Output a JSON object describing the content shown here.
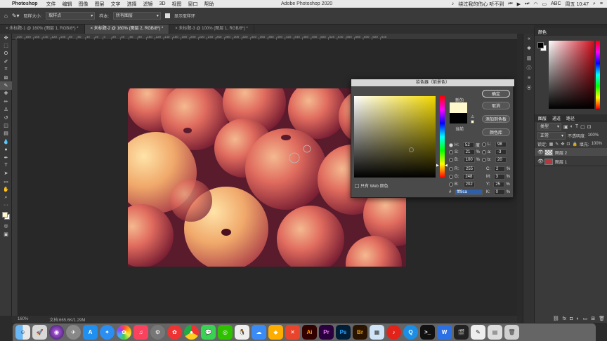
{
  "menubar": {
    "apple": "",
    "app_name": "Photoshop",
    "items": [
      "文件",
      "编辑",
      "图像",
      "图层",
      "文字",
      "选择",
      "滤镜",
      "3D",
      "视图",
      "窗口",
      "帮助"
    ],
    "window_title": "Adobe Photoshop 2020",
    "song": "绕过我的伤心 听不到",
    "input_method": "ABC",
    "clock": "周五 10:47"
  },
  "options_bar": {
    "sample_size_label": "取样大小:",
    "sample_size_value": "取样点",
    "sample_label": "样本:",
    "sample_value": "所有图层",
    "show_ring_label": "显示取样环"
  },
  "tabs": [
    {
      "label": "未标题-1 @ 160% (图层 1, RGB/8*) *",
      "active": false
    },
    {
      "label": "未标题-2 @ 160% (图层 2, RGB/8*) *",
      "active": true
    },
    {
      "label": "未标题-3 @ 100% (图层 1, RGB/8*) *",
      "active": false
    }
  ],
  "ruler_ticks": [
    "200",
    "180",
    "160",
    "140",
    "120",
    "100",
    "80",
    "60",
    "40",
    "20",
    "0",
    "20",
    "40",
    "60",
    "80",
    "100",
    "120",
    "140",
    "160",
    "180",
    "200",
    "220",
    "240",
    "260",
    "280",
    "300",
    "320",
    "340",
    "360",
    "380",
    "400",
    "420",
    "440",
    "460",
    "480",
    "500",
    "520",
    "540",
    "560",
    "580",
    "600",
    "620",
    "640"
  ],
  "status": {
    "zoom": "160%",
    "doc": "文档:665.6K/1.29M"
  },
  "color_picker": {
    "title": "拾色器（前景色）",
    "ok": "确定",
    "cancel": "取消",
    "add_swatch": "添加到色板",
    "libraries": "颜色库",
    "new_label": "新的",
    "current_label": "当前",
    "web_only_label": "只有 Web 颜色",
    "new_color": "#fff8ca",
    "current_color": "#000000",
    "fields": {
      "H": {
        "value": "52",
        "unit": "度"
      },
      "S": {
        "value": "21",
        "unit": "%"
      },
      "B": {
        "value": "100",
        "unit": "%"
      },
      "R": {
        "value": "255",
        "unit": ""
      },
      "G": {
        "value": "248",
        "unit": ""
      },
      "Bv": {
        "value": "202",
        "unit": ""
      },
      "L": {
        "value": "98",
        "unit": ""
      },
      "a": {
        "value": "-3",
        "unit": ""
      },
      "b": {
        "value": "20",
        "unit": ""
      },
      "C": {
        "value": "2",
        "unit": "%"
      },
      "M": {
        "value": "3",
        "unit": "%"
      },
      "Y": {
        "value": "25",
        "unit": "%"
      },
      "K": {
        "value": "0",
        "unit": "%"
      }
    },
    "hex_label": "#",
    "hex": "fff8ca"
  },
  "panels": {
    "color_tab": "颜色",
    "layers_tabs": [
      "图层",
      "通道",
      "路径"
    ],
    "kind_label": "类型",
    "blend_mode": "正常",
    "opacity_label": "不透明度:",
    "opacity_value": "100%",
    "lock_label": "锁定:",
    "fill_label": "填充:",
    "fill_value": "100%",
    "layers": [
      {
        "name": "图层 2",
        "selected": true
      },
      {
        "name": "图层 1",
        "selected": false
      }
    ]
  },
  "dock": {
    "apps": [
      "Finder",
      "Launchpad",
      "Siri",
      "Safari",
      "App Store",
      "Safari",
      "Photos",
      "Music",
      "System Preferences",
      "Chrome",
      "Messages",
      "WeChat",
      "QQ",
      "Baidu",
      "Sketch",
      "XMind",
      "Ai",
      "Pr",
      "Ps",
      "Br",
      "Preview",
      "NetEase Music",
      "Terminal",
      "W",
      "Final Cut",
      "Pen",
      "Folder",
      "Trash"
    ]
  },
  "colors": {
    "accent_fg": "#fff8ca",
    "panel_red": "#d10d1c"
  }
}
